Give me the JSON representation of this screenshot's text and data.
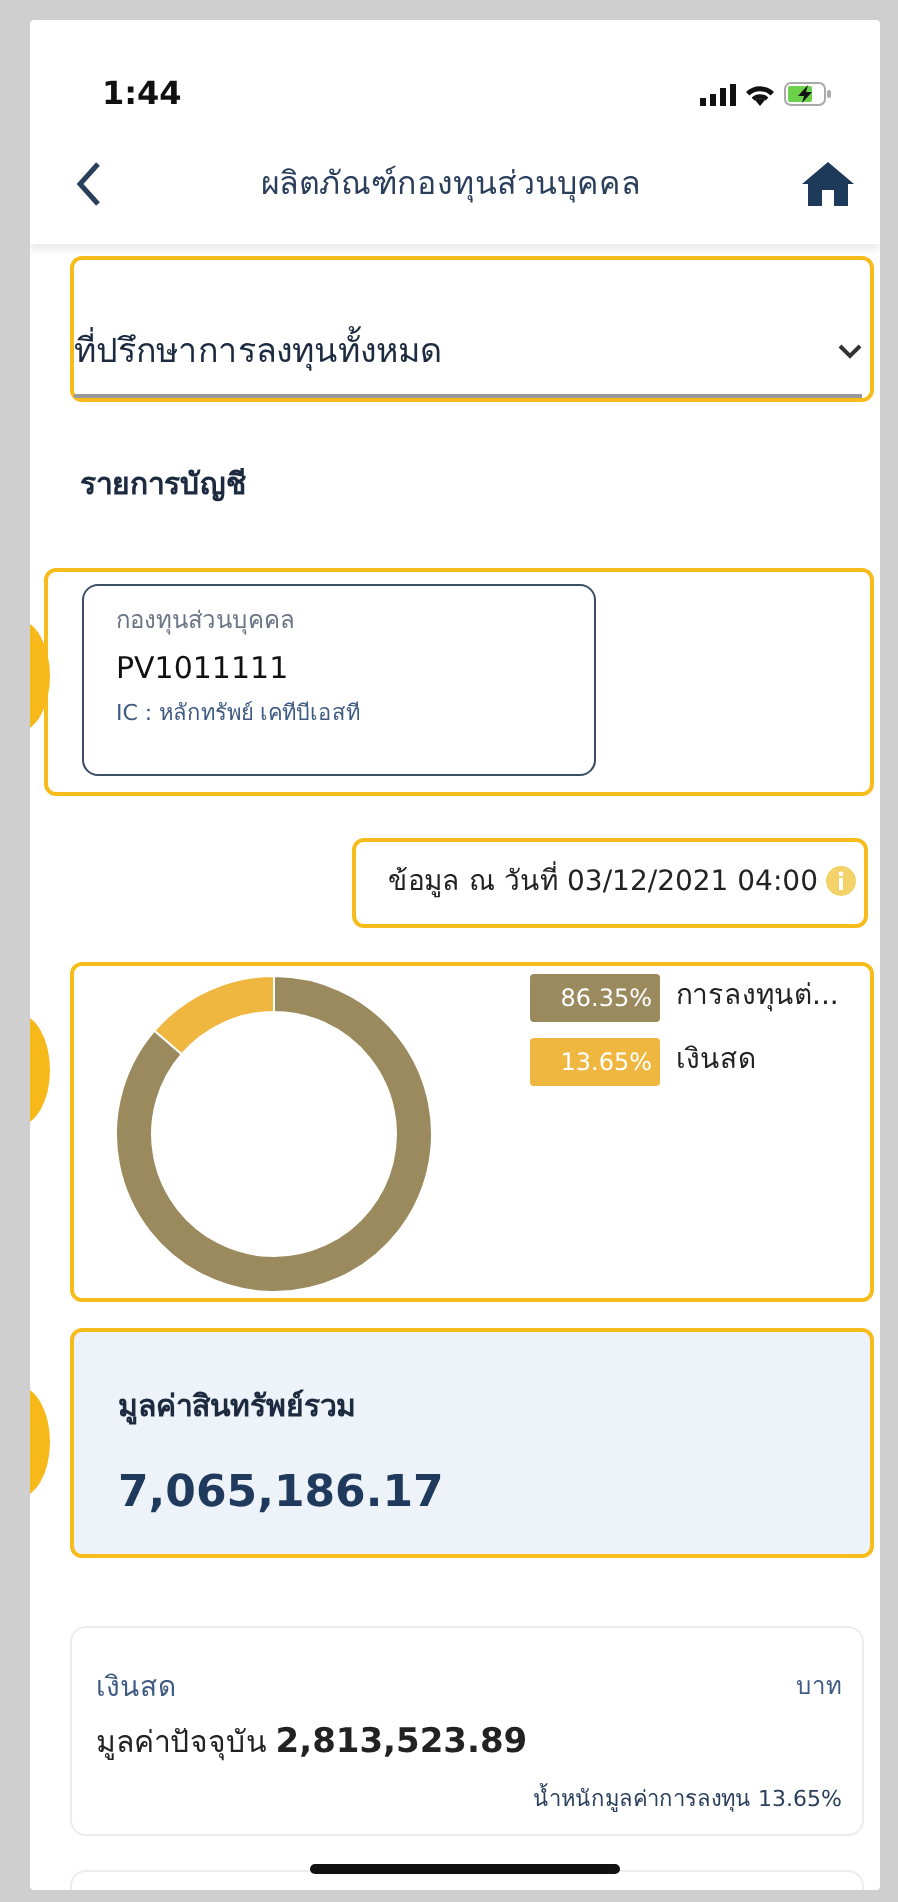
{
  "status_bar": {
    "time": "1:44"
  },
  "header": {
    "title": "ผลิตภัณฑ์กองทุนส่วนบุคคล"
  },
  "advisor_select": {
    "value": "ที่ปรึกษาการลงทุนทั้งหมด",
    "highlighted": true
  },
  "section_title": "รายการบัญชี",
  "account": {
    "type": "กองทุนส่วนบุคคล",
    "number": "PV1011111",
    "ic": "IC : หลักทรัพย์ เคทีบีเอสที",
    "highlighted": true,
    "marked": true
  },
  "as_of": {
    "text": "ข้อมูล ณ วันที่ 03/12/2021 04:00",
    "highlighted": true
  },
  "allocation": {
    "highlighted": true,
    "marked": true,
    "legend": [
      {
        "percent": "86.35%",
        "color": "#9a8a5e"
      },
      {
        "percent": "13.65%",
        "color": "#f0b740"
      }
    ],
    "chart_data": {
      "type": "donut",
      "categories": [
        "การลงทุนต่...",
        "เงินสด"
      ],
      "values": [
        86.35,
        13.65
      ]
    }
  },
  "total": {
    "label": "มูลค่าสินทรัพย์รวม",
    "value": "7,065,186.17",
    "highlighted": true,
    "marked": true
  },
  "holdings": [
    {
      "name": "เงินสด",
      "unit": "บาท",
      "value_label": "มูลค่าปัจจุบัน",
      "value": "2,813,523.89",
      "weight": "น้ำหนักมูลค่าการลงทุน 13.65%"
    }
  ]
}
